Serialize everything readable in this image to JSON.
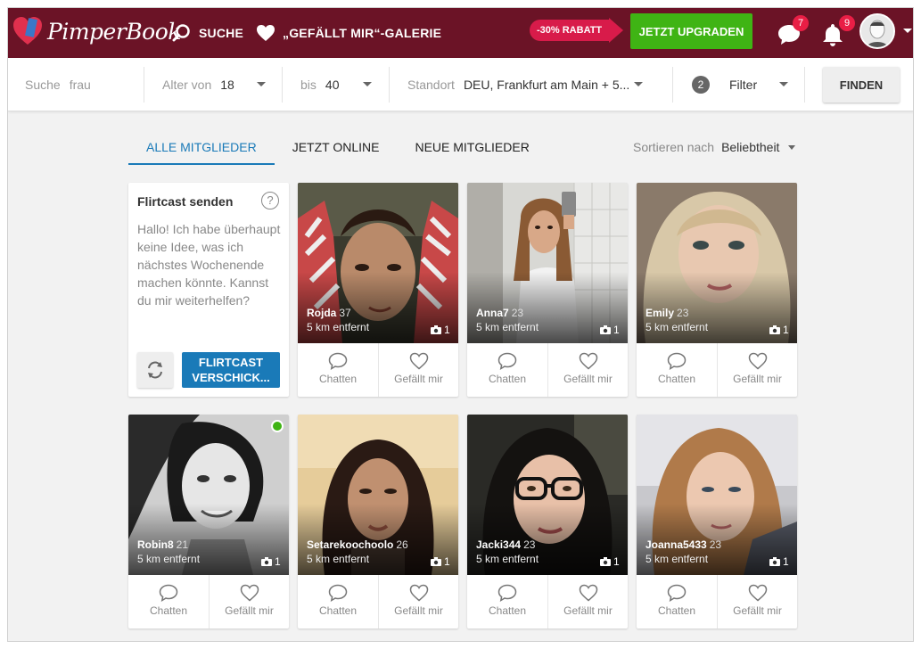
{
  "header": {
    "logo_text": "PimperBook",
    "nav_search": "SUCHE",
    "nav_gallery": "„GEFÄLLT MIR“-GALERIE",
    "promo": "-30% RABATT",
    "upgrade": "JETZT UPGRADEN",
    "messages_badge": "7",
    "notifications_badge": "9"
  },
  "search": {
    "query_label": "Suche",
    "query_value": "frau",
    "age_from_label": "Alter von",
    "age_from_value": "18",
    "age_to_label": "bis",
    "age_to_value": "40",
    "location_label": "Standort",
    "location_value": "DEU, Frankfurt am Main + 5...",
    "filter_count": "2",
    "filter_label": "Filter",
    "find_button": "FINDEN"
  },
  "tabs": [
    {
      "label": "ALLE MITGLIEDER"
    },
    {
      "label": "JETZT ONLINE"
    },
    {
      "label": "NEUE MITGLIEDER"
    }
  ],
  "sort": {
    "label": "Sortieren nach",
    "value": "Beliebtheit"
  },
  "flirtcast": {
    "title": "Flirtcast senden",
    "help": "?",
    "text": "Hallo! Ich habe überhaupt keine Idee, was ich nächstes Wochenende machen könnte. Kannst du mir weiterhelfen?",
    "send_line1": "FLIRTCAST",
    "send_line2": "VERSCHICK..."
  },
  "actions": {
    "chat": "Chatten",
    "like": "Gefällt mir"
  },
  "members": [
    {
      "name": "Rojda",
      "age": "37",
      "distance": "5 km entfernt",
      "photos": "1"
    },
    {
      "name": "Anna7",
      "age": "23",
      "distance": "5 km entfernt",
      "photos": "1"
    },
    {
      "name": "Emily",
      "age": "23",
      "distance": "5 km entfernt",
      "photos": "1"
    },
    {
      "name": "Robin8",
      "age": "21",
      "distance": "5 km entfernt",
      "photos": "1"
    },
    {
      "name": "Setarekoochoolo",
      "age": "26",
      "distance": "5 km entfernt",
      "photos": "1"
    },
    {
      "name": "Jacki344",
      "age": "23",
      "distance": "5 km entfernt",
      "photos": "1"
    },
    {
      "name": "Joanna5433",
      "age": "23",
      "distance": "5 km entfernt",
      "photos": "1"
    }
  ],
  "colors": {
    "header_bg": "#6b1326",
    "upgrade_green": "#3fb414",
    "promo_pink": "#d81b4a",
    "accent_blue": "#1a7ab8",
    "badge_red": "#e91e45"
  }
}
